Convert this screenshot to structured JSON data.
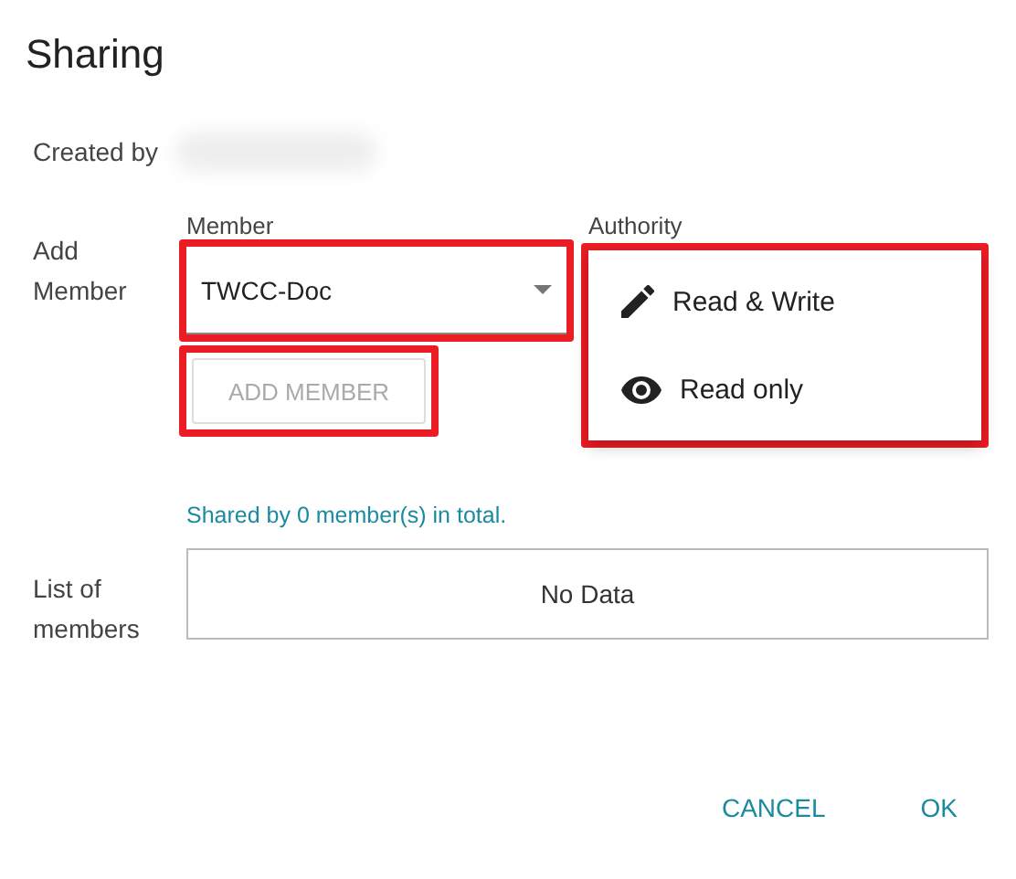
{
  "dialog": {
    "title": "Sharing"
  },
  "created_by": {
    "label": "Created by"
  },
  "add_member": {
    "label": "Add Member",
    "member_field": {
      "label": "Member",
      "value": "TWCC-Doc",
      "highlighted": true
    },
    "add_button": {
      "label": "ADD MEMBER",
      "disabled": true,
      "highlighted": true
    },
    "authority": {
      "label": "Authority",
      "menu": {
        "highlighted": true,
        "items": [
          {
            "label": "Read & Write",
            "kind": "pencil"
          },
          {
            "label": "Read only",
            "kind": "eye"
          }
        ]
      }
    }
  },
  "shared_summary": "Shared by 0 member(s) in total.",
  "members_list": {
    "label": "List of members",
    "empty_text": "No Data"
  },
  "buttons": [
    {
      "label": "CANCEL"
    },
    {
      "label": "OK"
    }
  ]
}
